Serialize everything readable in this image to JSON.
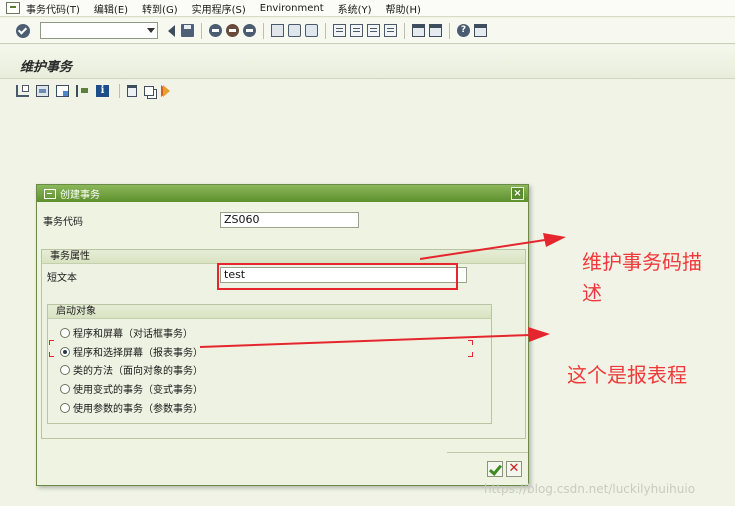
{
  "menu": {
    "items": [
      "事务代码(T)",
      "编辑(E)",
      "转到(G)",
      "实用程序(S)",
      "Environment",
      "系统(Y)",
      "帮助(H)"
    ]
  },
  "toolbar": {
    "command_value": ""
  },
  "page": {
    "title": "维护事务"
  },
  "dialog": {
    "title": "创建事务",
    "tcode_label": "事务代码",
    "tcode_value": "ZS060",
    "attr_group_title": "事务属性",
    "short_text_label": "短文本",
    "short_text_value": "test",
    "start_group_title": "启动对象",
    "radio_options": [
      {
        "label": "程序和屏幕（对话框事务）",
        "selected": false
      },
      {
        "label": "程序和选择屏幕（报表事务）",
        "selected": true
      },
      {
        "label": "类的方法（面向对象的事务）",
        "selected": false
      },
      {
        "label": "使用变式的事务（变式事务）",
        "selected": false
      },
      {
        "label": "使用参数的事务（参数事务）",
        "selected": false
      }
    ]
  },
  "annotations": {
    "note1": "维护事务码描\n述",
    "note1_line1": "维护事务码描",
    "note1_line2": "述",
    "note2": "这个是报表程",
    "accent_color": "#e5262e"
  },
  "watermark": "https://blog.csdn.net/luckilyhuihuio"
}
